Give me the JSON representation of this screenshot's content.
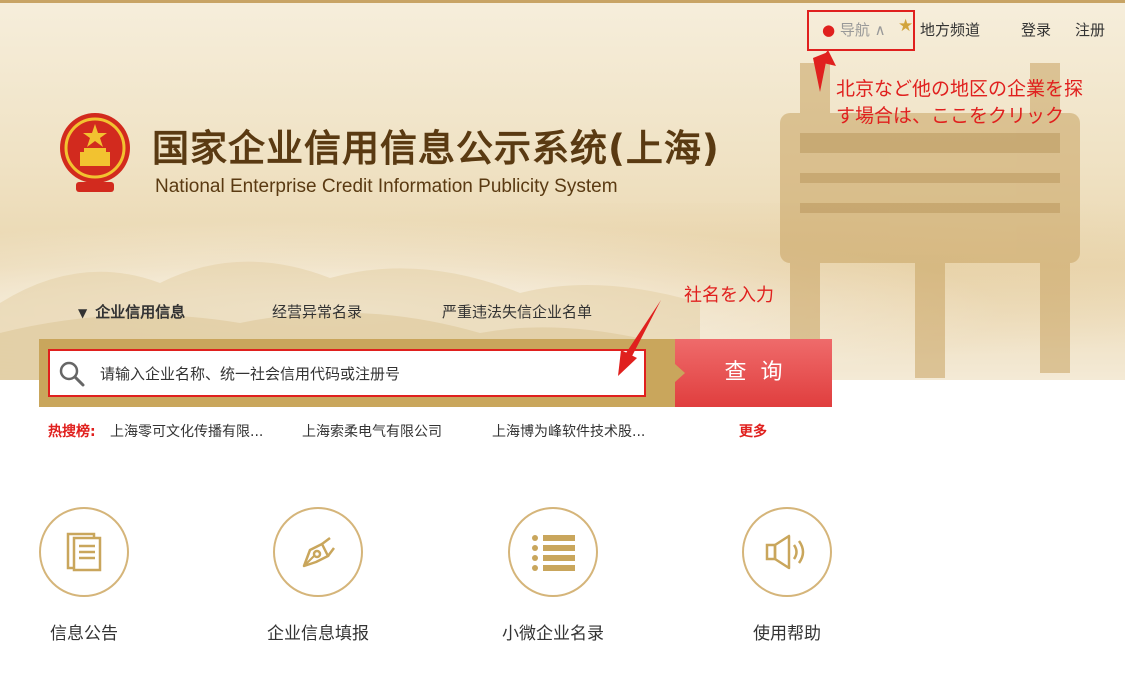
{
  "header": {
    "nav": {
      "daohang": "导航",
      "local_channel": "地方频道",
      "login": "登录",
      "register": "注册"
    },
    "title_cn": "国家企业信用信息公示系统(上海)",
    "title_en": "National Enterprise Credit Information Publicity System"
  },
  "annotations": {
    "nav_hint_line1": "北京など他の地区の企業を探",
    "nav_hint_line2": "す場合は、ここをクリック",
    "search_hint": "社名を入力"
  },
  "tabs": [
    {
      "label": "企业信用信息",
      "active": true
    },
    {
      "label": "经营异常名录",
      "active": false
    },
    {
      "label": "严重违法失信企业名单",
      "active": false
    }
  ],
  "search": {
    "placeholder": "请输入企业名称、统一社会信用代码或注册号",
    "button_label": "查询"
  },
  "hot_search": {
    "label": "热搜榜:",
    "items": [
      "上海零可文化传播有限...",
      "上海索柔电气有限公司",
      "上海博为峰软件技术股..."
    ],
    "more": "更多"
  },
  "features": [
    {
      "label": "信息公告",
      "icon": "document-icon"
    },
    {
      "label": "企业信息填报",
      "icon": "pen-icon"
    },
    {
      "label": "小微企业名录",
      "icon": "list-icon"
    },
    {
      "label": "使用帮助",
      "icon": "speaker-icon"
    }
  ],
  "colors": {
    "accent_red": "#e0201e",
    "gold": "#c9a65c",
    "title_brown": "#5a3a12"
  }
}
